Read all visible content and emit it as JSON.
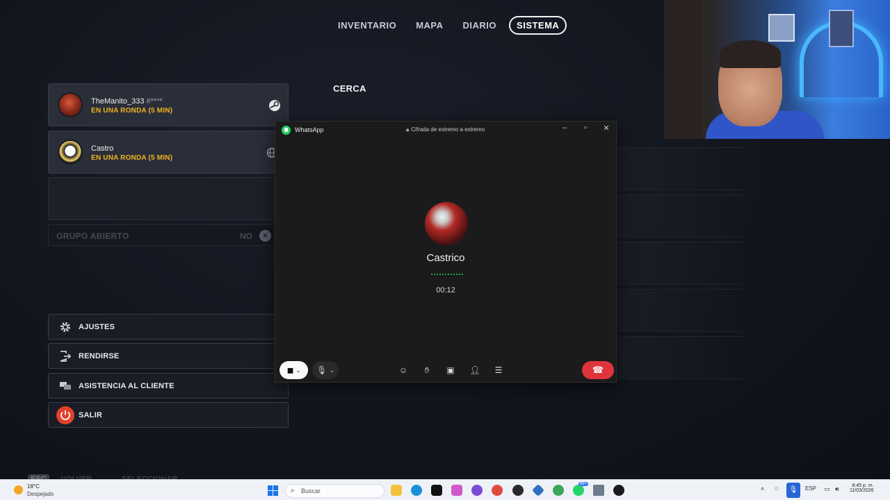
{
  "game": {
    "nav": {
      "tabs": [
        {
          "label": "INVENTARIO",
          "active": false
        },
        {
          "label": "MAPA",
          "active": false
        },
        {
          "label": "DIARIO",
          "active": false
        },
        {
          "label": "SISTEMA",
          "active": true
        }
      ]
    },
    "section_title": "CERCA",
    "party": [
      {
        "name": "TheManito_333",
        "tag": "#****",
        "status": "EN UNA RONDA (5 MIN)",
        "platform_icon": "steam-icon"
      },
      {
        "name": "Castro",
        "tag": "",
        "status": "EN UNA RONDA (5 MIN)",
        "platform_icon": "globe-icon"
      }
    ],
    "open_group": {
      "label": "GRUPO ABIERTO",
      "value": "NO"
    },
    "menu": [
      {
        "label": "AJUSTES",
        "icon": "gear-icon"
      },
      {
        "label": "RENDIRSE",
        "icon": "exit-door-icon"
      },
      {
        "label": "ASISTENCIA AL CLIENTE",
        "icon": "chat-bubbles-icon"
      },
      {
        "label": "SALIR",
        "icon": "power-icon"
      }
    ],
    "footer": {
      "esc_key": "ESC",
      "back_label": "VOLVER",
      "select_label": "SELECCIONAR"
    }
  },
  "whatsapp": {
    "app_name": "WhatsApp",
    "encryption": "Cifrada de extremo a extremo",
    "callee": "Castrico",
    "timer": "00:12",
    "controls": [
      "camera-off-icon",
      "mic-icon",
      "emoji-icon",
      "raise-hand-icon",
      "screen-share-icon",
      "add-person-icon",
      "more-icon",
      "end-call-icon"
    ]
  },
  "taskbar": {
    "weather": {
      "temp": "18°C",
      "condition": "Despejado"
    },
    "search_placeholder": "Buscar",
    "badge": "99+",
    "lang": "ESP",
    "time": "8:45 p. m.",
    "date": "11/03/2026",
    "colors": {
      "accent": "#2867d6",
      "end_call": "#e0343b",
      "status_gold": "#f0b323"
    }
  }
}
